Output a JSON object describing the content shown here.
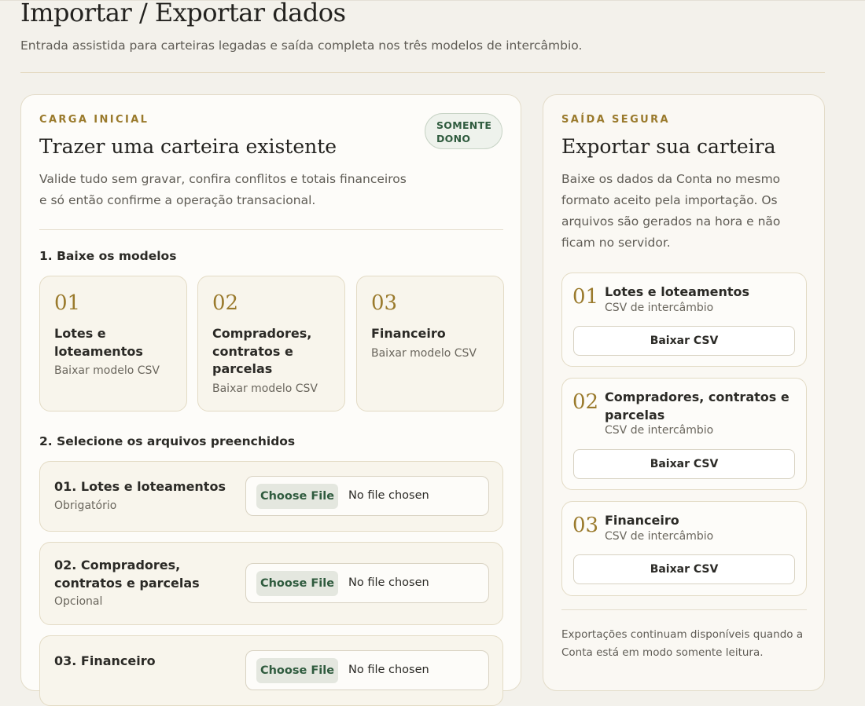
{
  "header": {
    "title": "Importar / Exportar dados",
    "subtitle": "Entrada assistida para carteiras legadas e saída completa nos três modelos de intercâmbio."
  },
  "import_card": {
    "eyebrow": "CARGA INICIAL",
    "title": "Trazer uma carteira existente",
    "badge": "SOMENTE DONO",
    "description": "Valide tudo sem gravar, confira conflitos e totais financeiros e só então confirme a operação transacional.",
    "step1_label": "1. Baixe os modelos",
    "models": [
      {
        "num": "01",
        "name": "Lotes e loteamentos",
        "link": "Baixar modelo CSV"
      },
      {
        "num": "02",
        "name": "Compradores, contratos e parcelas",
        "link": "Baixar modelo CSV"
      },
      {
        "num": "03",
        "name": "Financeiro",
        "link": "Baixar modelo CSV"
      }
    ],
    "step2_label": "2. Selecione os arquivos preenchidos",
    "files": [
      {
        "title": "01. Lotes e loteamentos",
        "note": "Obrigatório",
        "button": "Choose File",
        "status": "No file chosen"
      },
      {
        "title": "02. Compradores, contratos e parcelas",
        "note": "Opcional",
        "button": "Choose File",
        "status": "No file chosen"
      },
      {
        "title": "03. Financeiro",
        "note": "",
        "button": "Choose File",
        "status": "No file chosen"
      }
    ]
  },
  "export_card": {
    "eyebrow": "SAÍDA SEGURA",
    "title": "Exportar sua carteira",
    "description": "Baixe os dados da Conta no mesmo formato aceito pela importação. Os arquivos são gerados na hora e não ficam no servidor.",
    "exports": [
      {
        "num": "01",
        "name": "Lotes e loteamentos",
        "sub": "CSV de intercâmbio",
        "button": "Baixar CSV"
      },
      {
        "num": "02",
        "name": "Compradores, contratos e parcelas",
        "sub": "CSV de intercâmbio",
        "button": "Baixar CSV"
      },
      {
        "num": "03",
        "name": "Financeiro",
        "sub": "CSV de intercâmbio",
        "button": "Baixar CSV"
      }
    ],
    "note": "Exportações continuam disponíveis quando a Conta está em modo somente leitura."
  },
  "colors": {
    "background": "#f3f1eb",
    "accent_gold": "#9a7a2c",
    "badge_green": "#2f5b3e"
  }
}
